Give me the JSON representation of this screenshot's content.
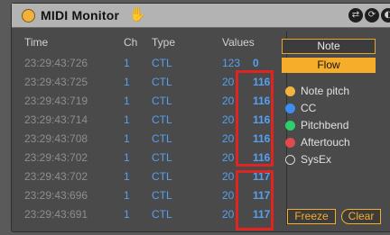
{
  "window": {
    "title": "MIDI Monitor",
    "hand_icon": "hand-icon",
    "buttons": [
      "⇄",
      "⟳",
      "◐"
    ]
  },
  "table": {
    "headers": {
      "time": "Time",
      "ch": "Ch",
      "type": "Type",
      "values": "Values"
    },
    "rows": [
      {
        "time": "23:29:43:726",
        "ch": "1",
        "type": "CTL",
        "v1": "123",
        "v2": "0"
      },
      {
        "time": "23:29:43:725",
        "ch": "1",
        "type": "CTL",
        "v1": "20",
        "v2": "116"
      },
      {
        "time": "23:29:43:719",
        "ch": "1",
        "type": "CTL",
        "v1": "20",
        "v2": "116"
      },
      {
        "time": "23:29:43:714",
        "ch": "1",
        "type": "CTL",
        "v1": "20",
        "v2": "116"
      },
      {
        "time": "23:29:43:708",
        "ch": "1",
        "type": "CTL",
        "v1": "20",
        "v2": "116"
      },
      {
        "time": "23:29:43:702",
        "ch": "1",
        "type": "CTL",
        "v1": "20",
        "v2": "116"
      },
      {
        "time": "23:29:43:702",
        "ch": "1",
        "type": "CTL",
        "v1": "20",
        "v2": "117"
      },
      {
        "time": "23:29:43:696",
        "ch": "1",
        "type": "CTL",
        "v1": "20",
        "v2": "117"
      },
      {
        "time": "23:29:43:691",
        "ch": "1",
        "type": "CTL",
        "v1": "20",
        "v2": "117"
      }
    ]
  },
  "side": {
    "mode_buttons": [
      {
        "label": "Note",
        "active": false
      },
      {
        "label": "Flow",
        "active": true
      }
    ],
    "legend": [
      {
        "label": "Note pitch",
        "color": "#f2b43c"
      },
      {
        "label": "CC",
        "color": "#3c8ef0"
      },
      {
        "label": "Pitchbend",
        "color": "#2ecf6a"
      },
      {
        "label": "Aftertouch",
        "color": "#e04a4a"
      },
      {
        "label": "SysEx",
        "color": "hollow"
      }
    ],
    "freeze_label": "Freeze",
    "clear_label": "Clear"
  }
}
